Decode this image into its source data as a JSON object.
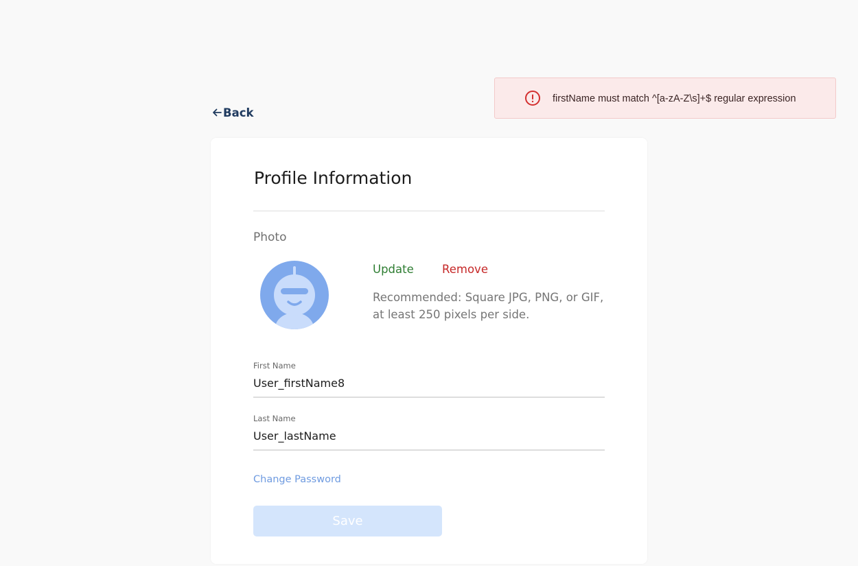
{
  "toast": {
    "message": "firstName must match ^[a-zA-Z\\s]+$ regular expression",
    "icon": "error-circle-icon",
    "color": "#d32f2f",
    "background": "#fbeaea"
  },
  "nav": {
    "back_label": "Back",
    "back_icon": "arrow-left-icon"
  },
  "profile": {
    "title": "Profile Information",
    "photo_label": "Photo",
    "update_label": "Update",
    "remove_label": "Remove",
    "photo_hint": "Recommended: Square JPG, PNG, or GIF, at least 250 pixels per side.",
    "avatar_icon": "robot-avatar-icon",
    "first_name": {
      "label": "First Name",
      "value": "User_firstName8"
    },
    "last_name": {
      "label": "Last Name",
      "value": "User_lastName"
    },
    "change_password_label": "Change Password",
    "save_label": "Save"
  },
  "colors": {
    "update": "#2e7d32",
    "remove": "#c62828",
    "link": "#6f9be0",
    "save_disabled": "#d4e5fc",
    "back": "#1f3a5f"
  }
}
